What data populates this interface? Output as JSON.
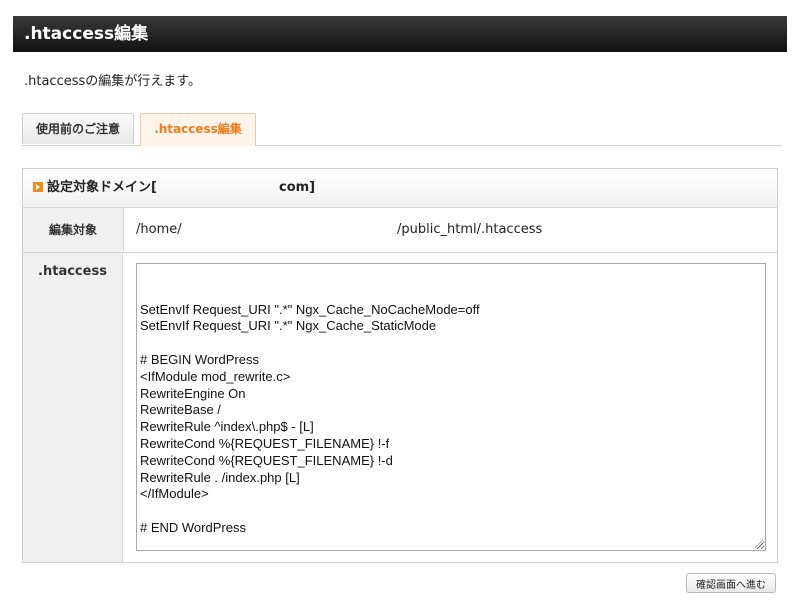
{
  "header": {
    "title": ".htaccess編集"
  },
  "description": ".htaccessの編集が行えます。",
  "tabs": [
    {
      "label": "使用前のご注意",
      "active": false
    },
    {
      "label": ".htaccess編集",
      "active": true
    }
  ],
  "panel": {
    "heading_prefix": "設定対象ドメイン[",
    "heading_suffix": "com]",
    "target": {
      "label": "編集対象",
      "path_start": "/home/",
      "path_end": "/public_html/.htaccess"
    },
    "htaccess": {
      "label": ".htaccess",
      "lines": [
        "SetEnvIf Request_URI \".*\" Ngx_Cache_NoCacheMode=off",
        "SetEnvIf Request_URI \".*\" Ngx_Cache_StaticMode",
        "",
        "# BEGIN WordPress",
        "<IfModule mod_rewrite.c>",
        "RewriteEngine On",
        "RewriteBase /",
        "RewriteRule ^index\\.php$ - [L]",
        "RewriteCond %{REQUEST_FILENAME} !-f",
        "RewriteCond %{REQUEST_FILENAME} !-d",
        "RewriteRule . /index.php [L]",
        "</IfModule>",
        "",
        "# END WordPress"
      ]
    }
  },
  "confirm_button": "確認画面へ進む",
  "colors": {
    "accent": "#f07d1a",
    "header_bg": "#1a1a1a"
  }
}
